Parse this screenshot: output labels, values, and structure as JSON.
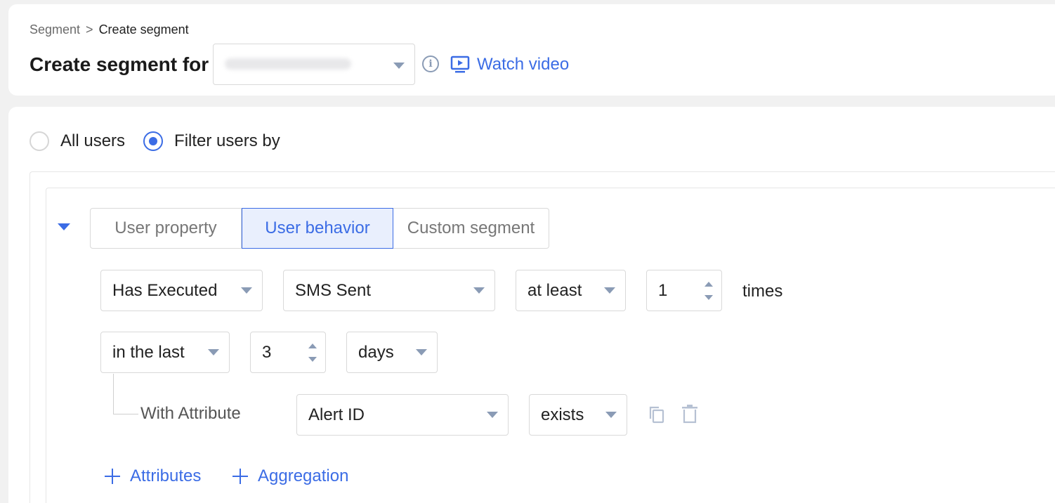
{
  "breadcrumb": {
    "parent": "Segment",
    "separator": ">",
    "current": "Create segment"
  },
  "header": {
    "title": "Create segment for",
    "app_select_value": "",
    "watch_video": "Watch video"
  },
  "audience": {
    "all_users": "All users",
    "filter_users": "Filter users by",
    "selected": "filter_users"
  },
  "tabs": [
    {
      "label": "User property",
      "active": false
    },
    {
      "label": "User behavior",
      "active": true
    },
    {
      "label": "Custom segment",
      "active": false
    }
  ],
  "condition": {
    "execution": "Has Executed",
    "event": "SMS Sent",
    "comparator": "at least",
    "count": "1",
    "count_suffix": "times",
    "time_operator": "in the last",
    "time_value": "3",
    "time_unit": "days"
  },
  "attribute_filter": {
    "label": "With Attribute",
    "attribute": "Alert ID",
    "operator": "exists"
  },
  "actions": {
    "add_attributes": "Attributes",
    "add_aggregation": "Aggregation"
  },
  "colors": {
    "accent": "#3b6ce5",
    "tab_active_bg": "#e9effd",
    "icon_muted": "#8a9bb5"
  }
}
